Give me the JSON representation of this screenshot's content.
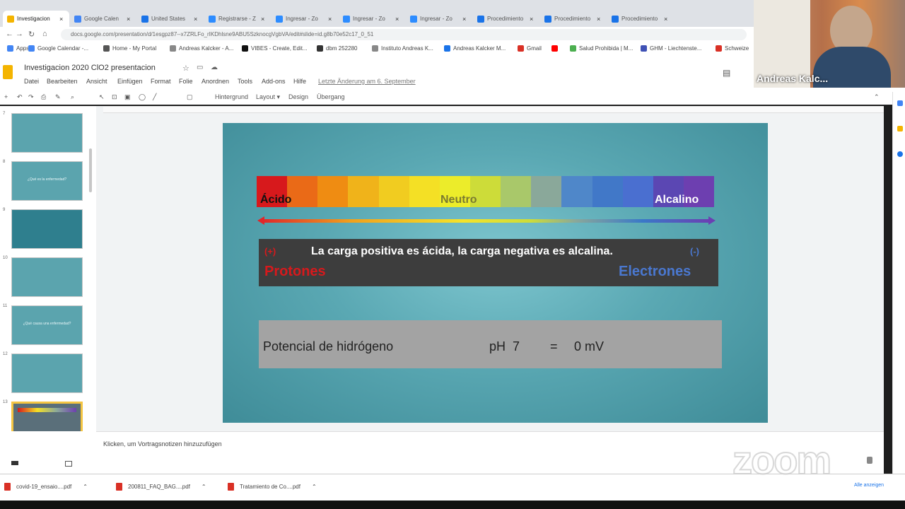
{
  "browser": {
    "tabs": [
      {
        "label": "Investigacion",
        "color": "#f4b400",
        "active": true
      },
      {
        "label": "Google Calen",
        "color": "#4285f4"
      },
      {
        "label": "United States",
        "color": "#1a73e8"
      },
      {
        "label": "Registrarse - Z",
        "color": "#2d8cff"
      },
      {
        "label": "Ingresar - Zo",
        "color": "#2d8cff"
      },
      {
        "label": "Ingresar - Zo",
        "color": "#2d8cff"
      },
      {
        "label": "Ingresar - Zo",
        "color": "#2d8cff"
      },
      {
        "label": "Procedimiento",
        "color": "#1a73e8"
      },
      {
        "label": "Procedimiento",
        "color": "#1a73e8"
      },
      {
        "label": "Procedimiento",
        "color": "#1a73e8"
      }
    ],
    "url": "docs.google.com/presentation/d/1esgpz87--x7ZRLFo_rIKDhlsne9ABU5SzknocgVgbVA/edit#slide=id.g8b70e52c17_0_51",
    "bookmarks": [
      {
        "label": "Apps",
        "color": "#4285f4"
      },
      {
        "label": "Google Calendar -...",
        "color": "#4285f4"
      },
      {
        "label": "Home - My Portal",
        "color": "#555555"
      },
      {
        "label": "Andreas Kalcker - A...",
        "color": "#888888"
      },
      {
        "label": "VIBES - Create, Edit...",
        "color": "#111111"
      },
      {
        "label": "dbm 252280",
        "color": "#333333"
      },
      {
        "label": "Instituto Andreas K...",
        "color": "#888888"
      },
      {
        "label": "Andreas Kalcker M...",
        "color": "#1a73e8"
      },
      {
        "label": "Gmail",
        "color": "#d93025"
      },
      {
        "label": "",
        "color": "#ff0000"
      },
      {
        "label": "Salud Prohibida | M...",
        "color": "#4caf50"
      },
      {
        "label": "GHM - Liechtenste...",
        "color": "#3f51b5"
      },
      {
        "label": "Schweize",
        "color": "#d93025"
      }
    ]
  },
  "app": {
    "title": "Investigacion 2020 ClO2 presentacion",
    "menu": [
      "Datei",
      "Bearbeiten",
      "Ansicht",
      "Einfügen",
      "Format",
      "Folie",
      "Anordnen",
      "Tools",
      "Add-ons",
      "Hilfe"
    ],
    "last_edit": "Letzte Änderung am 6. September",
    "toolbar": [
      "Hintergrund",
      "Layout ▾",
      "Design",
      "Übergang"
    ],
    "speaker_notes": "Klicken, um Vortragsnotizen hinzuzufügen"
  },
  "filmstrip": {
    "slides": [
      {
        "num": "7",
        "text": ""
      },
      {
        "num": "8",
        "text": "¿Qué es la enfermedad?"
      },
      {
        "num": "9",
        "text": ""
      },
      {
        "num": "10",
        "text": ""
      },
      {
        "num": "11",
        "text": "¿Qué causa una enfermedad?"
      },
      {
        "num": "12",
        "text": ""
      },
      {
        "num": "13",
        "text": "",
        "selected": true
      },
      {
        "num": "14",
        "text": ""
      }
    ]
  },
  "slide": {
    "spectrum_colors": [
      "#d7191c",
      "#ea6a17",
      "#ef8c12",
      "#f0b31a",
      "#f1cc20",
      "#f4e025",
      "#ecec2a",
      "#cddc39",
      "#a9c86a",
      "#8aa89a",
      "#4f87c9",
      "#4178c8",
      "#4a6fd0",
      "#5b47b3",
      "#6d3fb0"
    ],
    "label_acid": "Ácido",
    "label_neutral": "Neutro",
    "label_alkaline": "Alcalino",
    "charge_statement": "La carga positiva es ácida, la carga negativa es alcalina.",
    "plus_sign": "(+)",
    "minus_sign": "(-)",
    "protons": "Protones",
    "electrons": "Electrones",
    "hydrogen_label": "Potencial de hidrógeno",
    "ph_label": "pH  7",
    "equals": "=",
    "mv_value": "0 mV"
  },
  "downloads": [
    {
      "label": "covid-19_ensaio....pdf"
    },
    {
      "label": "200811_FAQ_BAG....pdf"
    },
    {
      "label": "Tratamiento de Co....pdf"
    }
  ],
  "downloads_all": "Alle anzeigen",
  "zoom": {
    "speaker_name": "Andreas Kalc...",
    "logo_text": "zoom"
  }
}
